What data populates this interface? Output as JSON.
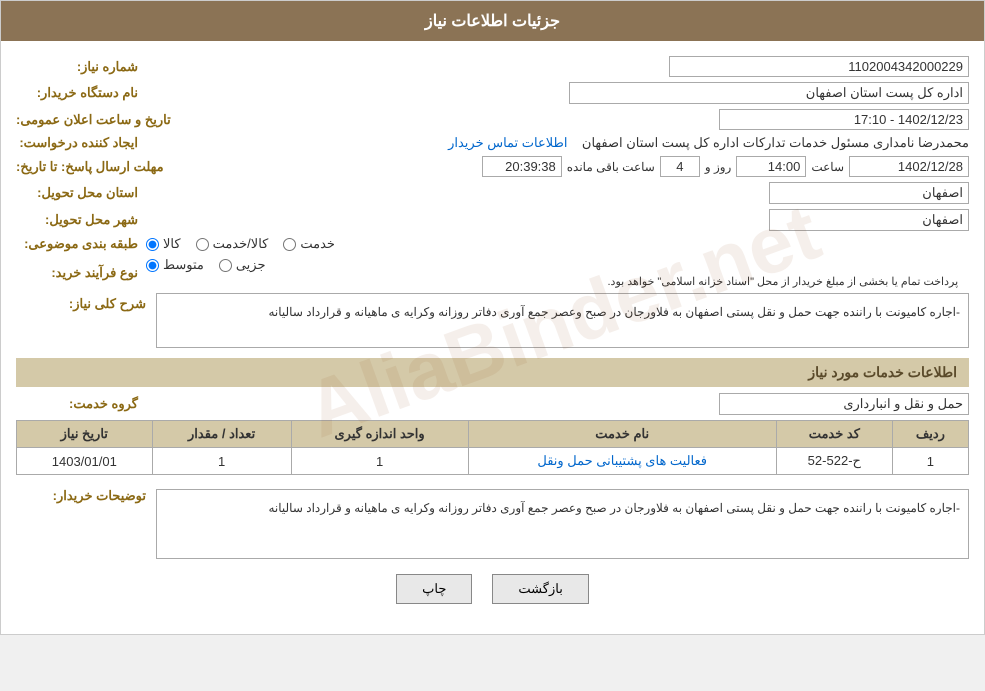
{
  "header": {
    "title": "جزئیات اطلاعات نیاز"
  },
  "fields": {
    "need_number_label": "شماره نیاز:",
    "need_number_value": "1102004342000229",
    "buyer_org_label": "نام دستگاه خریدار:",
    "buyer_org_value": "اداره کل پست استان اصفهان",
    "announcement_date_label": "تاریخ و ساعت اعلان عمومی:",
    "announcement_date_value": "1402/12/23 - 17:10",
    "creator_label": "ایجاد کننده درخواست:",
    "creator_value": "محمدرضا نامداری مسئول خدمات تدارکات اداره کل پست استان اصفهان",
    "contact_link": "اطلاعات تماس خریدار",
    "deadline_label": "مهلت ارسال پاسخ: تا تاریخ:",
    "deadline_date": "1402/12/28",
    "deadline_time_label": "ساعت",
    "deadline_time": "14:00",
    "deadline_days_label": "روز و",
    "deadline_days": "4",
    "deadline_remaining_label": "ساعت باقی مانده",
    "deadline_remaining": "20:39:38",
    "province_label": "استان محل تحویل:",
    "province_value": "اصفهان",
    "city_label": "شهر محل تحویل:",
    "city_value": "اصفهان",
    "category_label": "طبقه بندی موضوعی:",
    "category_options": [
      "خدمت",
      "کالا/خدمت",
      "کالا"
    ],
    "category_selected": "کالا",
    "process_label": "نوع فرآیند خرید:",
    "process_options": [
      "جزیی",
      "متوسط"
    ],
    "process_selected": "متوسط",
    "process_note": "پرداخت تمام یا بخشی از مبلغ خریدار از محل \"اسناد خزانه اسلامی\" خواهد بود."
  },
  "need_description": {
    "section_title": "شرح کلی نیاز:",
    "description": "-اجاره کامیونت با راننده جهت حمل و نقل پستی اصفهان به فلاورجان در صبح وعصر جمع آوری دفاتر  روزانه وکرایه ی ماهیانه و قرارداد سالیانه"
  },
  "services": {
    "section_title": "اطلاعات خدمات مورد نیاز",
    "service_group_label": "گروه خدمت:",
    "service_group_value": "حمل و نقل و انبارداری",
    "table_headers": [
      "ردیف",
      "کد خدمت",
      "نام خدمت",
      "واحد اندازه گیری",
      "تعداد / مقدار",
      "تاریخ نیاز"
    ],
    "table_rows": [
      {
        "row": "1",
        "code": "ح-522-52",
        "name": "فعالیت های پشتیبانی حمل ونقل",
        "unit": "1",
        "quantity": "1",
        "date": "1403/01/01"
      }
    ]
  },
  "buyer_description": {
    "label": "توضیحات خریدار:",
    "text": "-اجاره کامیونت با راننده جهت حمل و نقل پستی اصفهان به فلاورجان در صبح وعصر جمع آوری دفاتر  روزانه وکرایه ی ماهیانه و قرارداد سالیانه"
  },
  "buttons": {
    "print": "چاپ",
    "back": "بازگشت"
  }
}
